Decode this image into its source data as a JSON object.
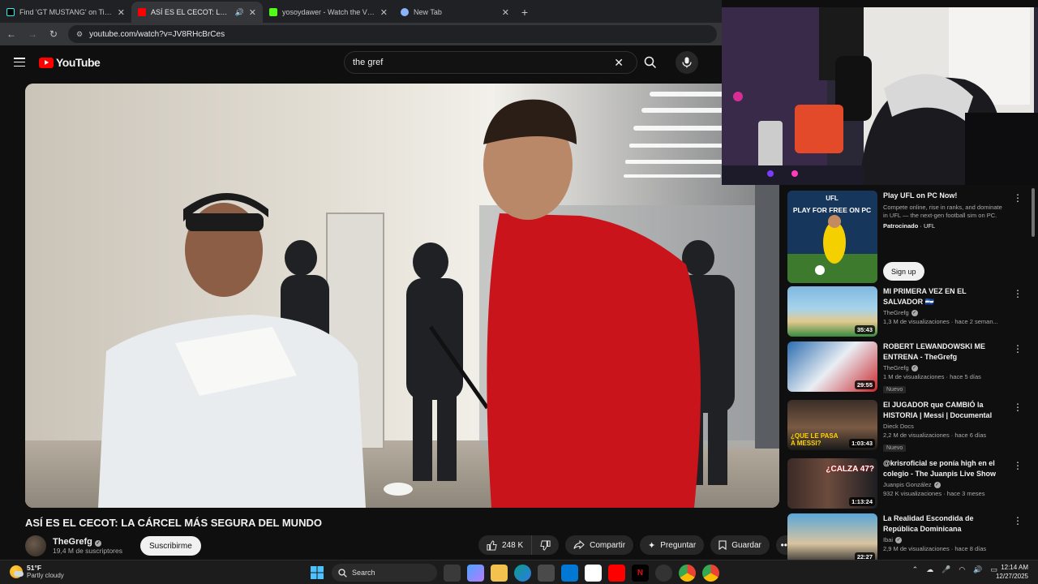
{
  "browser": {
    "tabs": [
      {
        "title": "Find 'GT MUSTANG' on TikTok |",
        "active": false
      },
      {
        "title": "ASÍ ES EL CECOT: LA CÁRC",
        "active": true
      },
      {
        "title": "yosoydawer - Watch the VOD c",
        "active": false
      },
      {
        "title": "New Tab",
        "active": false
      }
    ],
    "url": "youtube.com/watch?v=JV8RHcBrCes"
  },
  "youtube": {
    "logo_text": "YouTube",
    "search_query": "the gref"
  },
  "video": {
    "title": "ASÍ ES EL CECOT: LA CÁRCEL MÁS SEGURA DEL MUNDO",
    "channel_name": "TheGrefg",
    "subscribers": "19,4 M de suscriptores",
    "subscribe_label": "Suscribirme",
    "likes": "248 K",
    "share_label": "Compartir",
    "ask_label": "Preguntar",
    "save_label": "Guardar"
  },
  "recommendations": {
    "ad": {
      "title": "Play UFL on PC Now!",
      "description": "Compete online, rise in ranks, and dominate in UFL — the next-gen football sim on PC.",
      "sponsored": "Patrocinado",
      "advertiser": "UFL",
      "cta": "Sign up",
      "thumb_line1": "UFL",
      "thumb_line2": "PLAY FOR FREE ON PC"
    },
    "items": [
      {
        "title": "MI PRIMERA VEZ EN EL SALVADOR 🇸🇻",
        "channel": "TheGrefg",
        "stats": "1,3 M de visualizaciones · hace 2 seman...",
        "duration": "35:43",
        "badge": ""
      },
      {
        "title": "ROBERT LEWANDOWSKI ME ENTRENA - TheGrefg",
        "channel": "TheGrefg",
        "stats": "1 M de visualizaciones · hace 5 días",
        "duration": "29:55",
        "badge": "Nuevo"
      },
      {
        "title": "El JUGADOR que CAMBIÓ la HISTORIA | Messi | Documental",
        "channel": "Dieck Docs",
        "stats": "2,2 M de visualizaciones · hace 6 días",
        "duration": "1:03:43",
        "badge": "Nuevo",
        "thumb_text": "¿QUE LE PASA A MESSI?"
      },
      {
        "title": "@krisroficial se ponía high en el colegio - The Juanpis Live Show",
        "channel": "Juanpis González",
        "stats": "932 K visualizaciones · hace 3 meses",
        "duration": "1:13:24",
        "badge": "",
        "thumb_text": "¿CALZA 47?"
      },
      {
        "title": "La Realidad Escondida de República Dominicana",
        "channel": "Ibai",
        "stats": "2,9 M de visualizaciones · hace 8 días",
        "duration": "22:27",
        "badge": ""
      }
    ]
  },
  "taskbar": {
    "temperature": "51°F",
    "weather": "Partly cloudy",
    "search_label": "Search",
    "time": "12:14 AM",
    "date": "12/27/2025"
  },
  "colors": {
    "background": "#0f0f0f",
    "accent_red": "#ff0000",
    "text_primary": "#f1f1f1",
    "text_secondary": "#aaaaaa"
  }
}
